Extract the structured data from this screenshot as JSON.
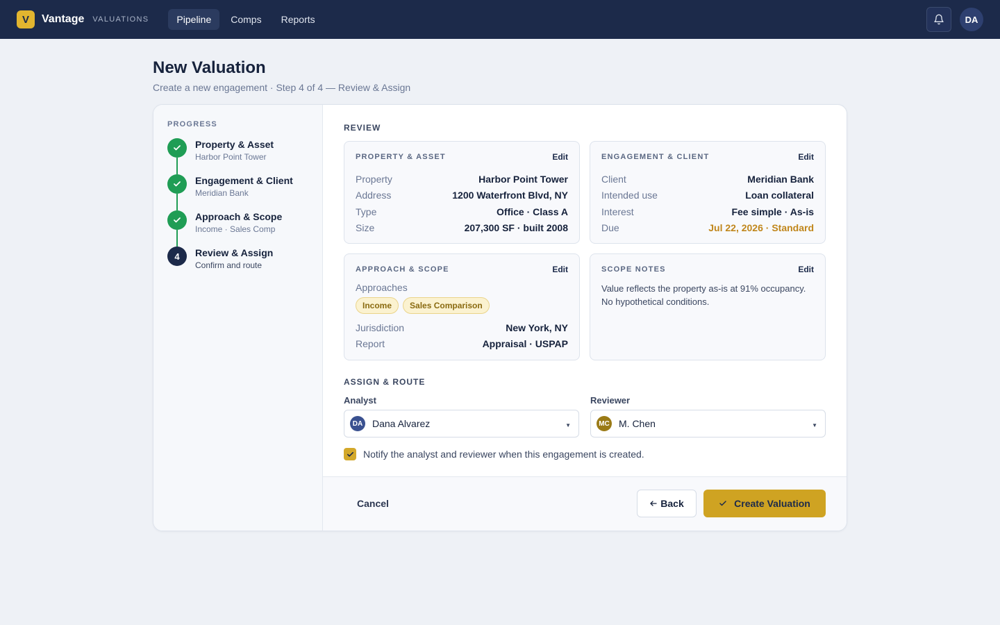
{
  "app": {
    "logo_letter": "V",
    "brand": "Vantage",
    "brand_sub": "VALUATIONS",
    "nav": [
      {
        "label": "Pipeline",
        "active": true
      },
      {
        "label": "Comps",
        "active": false
      },
      {
        "label": "Reports",
        "active": false
      }
    ],
    "user_initials": "DA",
    "icons": [
      "bell-icon",
      "check-icon",
      "arrow-left-icon",
      "chevron-down-icon"
    ]
  },
  "header": {
    "title": "New Valuation",
    "subtitle": "Create a new engagement · Step 4 of 4 — Review & Assign"
  },
  "progress": {
    "label": "PROGRESS",
    "steps": [
      {
        "title": "Property & Asset",
        "sub": "Harbor Point Tower",
        "status": "done"
      },
      {
        "title": "Engagement & Client",
        "sub": "Meridian Bank",
        "status": "done"
      },
      {
        "title": "Approach & Scope",
        "sub": "Income · Sales Comp",
        "status": "done"
      },
      {
        "title": "Review & Assign",
        "sub": "Confirm and route",
        "status": "current",
        "number": "4"
      }
    ]
  },
  "review": {
    "label": "REVIEW",
    "edit_label": "Edit",
    "property": {
      "title": "PROPERTY & ASSET",
      "rows": [
        {
          "k": "Property",
          "v": "Harbor Point Tower"
        },
        {
          "k": "Address",
          "v": "1200 Waterfront Blvd, NY"
        },
        {
          "k": "Type",
          "v": "Office · Class A"
        },
        {
          "k": "Size",
          "v": "207,300 SF · built 2008"
        }
      ]
    },
    "engagement": {
      "title": "ENGAGEMENT & CLIENT",
      "rows": [
        {
          "k": "Client",
          "v": "Meridian Bank"
        },
        {
          "k": "Intended use",
          "v": "Loan collateral"
        },
        {
          "k": "Interest",
          "v": "Fee simple · As-is"
        },
        {
          "k": "Due",
          "v": "Jul 22, 2026 · Standard"
        }
      ],
      "due_color": "#c0861b"
    },
    "approach": {
      "title": "APPROACH & SCOPE",
      "approaches_label": "Approaches",
      "chips": [
        "Income",
        "Sales Comparison"
      ],
      "rows": [
        {
          "k": "Jurisdiction",
          "v": "New York, NY"
        },
        {
          "k": "Report",
          "v": "Appraisal · USPAP"
        }
      ]
    },
    "notes": {
      "title": "SCOPE NOTES",
      "text": "Value reflects the property as-is at 91% occupancy. No hypothetical conditions."
    }
  },
  "assign": {
    "label": "ASSIGN & ROUTE",
    "analyst": {
      "label": "Analyst",
      "initials": "DA",
      "value": "Dana Alvarez"
    },
    "reviewer": {
      "label": "Reviewer",
      "initials": "MC",
      "value": "M. Chen"
    },
    "notify": {
      "checked": true,
      "text": "Notify the analyst and reviewer when this engagement is created."
    }
  },
  "footer": {
    "cancel": "Cancel",
    "back": "Back",
    "create": "Create Valuation"
  },
  "colors": {
    "nav_bg": "#1c2a4a",
    "accent_gold": "#cfa322",
    "success_green": "#1f9d55"
  }
}
